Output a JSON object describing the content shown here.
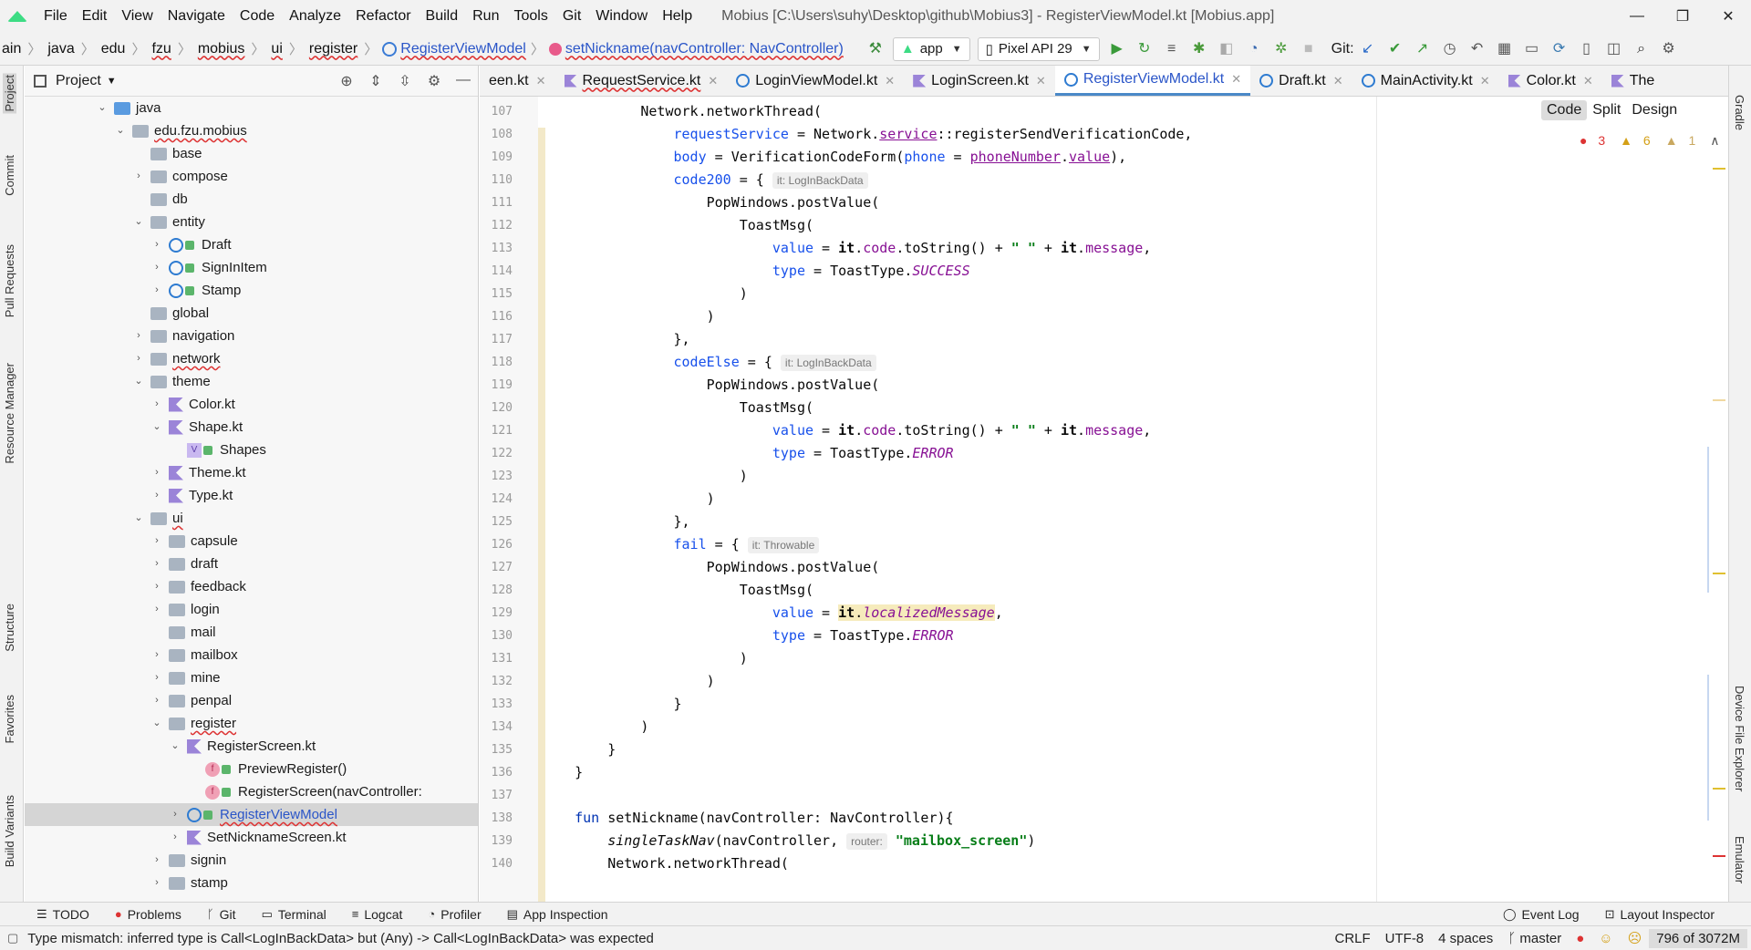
{
  "window": {
    "title": "Mobius [C:\\Users\\suhy\\Desktop\\github\\Mobius3] - RegisterViewModel.kt [Mobius.app]",
    "minimize": "—",
    "restore": "❐",
    "close": "✕"
  },
  "menu": [
    "File",
    "Edit",
    "View",
    "Navigate",
    "Code",
    "Analyze",
    "Refactor",
    "Build",
    "Run",
    "Tools",
    "Git",
    "Window",
    "Help"
  ],
  "breadcrumb": {
    "items": [
      "ain",
      "java",
      "edu",
      "fzu",
      "mobius",
      "ui",
      "register"
    ],
    "class_name": "RegisterViewModel",
    "function_name": "setNickname(navController: NavController)"
  },
  "toolbar": {
    "run_config": "app",
    "device": "Pixel API 29",
    "git_label": "Git:"
  },
  "project_panel": {
    "title": "Project",
    "tree": [
      {
        "label": "java",
        "depth": 0,
        "arrow": "down",
        "icon": "folder-blue"
      },
      {
        "label": "edu.fzu.mobius",
        "depth": 1,
        "arrow": "down",
        "icon": "folder",
        "underline": true
      },
      {
        "label": "base",
        "depth": 2,
        "arrow": "",
        "icon": "folder"
      },
      {
        "label": "compose",
        "depth": 2,
        "arrow": "right",
        "icon": "folder"
      },
      {
        "label": "db",
        "depth": 2,
        "arrow": "",
        "icon": "folder"
      },
      {
        "label": "entity",
        "depth": 2,
        "arrow": "down",
        "icon": "folder"
      },
      {
        "label": "Draft",
        "depth": 3,
        "arrow": "right",
        "icon": "class"
      },
      {
        "label": "SignInItem",
        "depth": 3,
        "arrow": "right",
        "icon": "class"
      },
      {
        "label": "Stamp",
        "depth": 3,
        "arrow": "right",
        "icon": "class"
      },
      {
        "label": "global",
        "depth": 2,
        "arrow": "",
        "icon": "folder"
      },
      {
        "label": "navigation",
        "depth": 2,
        "arrow": "right",
        "icon": "folder"
      },
      {
        "label": "network",
        "depth": 2,
        "arrow": "right",
        "icon": "folder",
        "underline": true
      },
      {
        "label": "theme",
        "depth": 2,
        "arrow": "down",
        "icon": "folder"
      },
      {
        "label": "Color.kt",
        "depth": 3,
        "arrow": "right",
        "icon": "kfile"
      },
      {
        "label": "Shape.kt",
        "depth": 3,
        "arrow": "down",
        "icon": "kfile"
      },
      {
        "label": "Shapes",
        "depth": 4,
        "arrow": "",
        "icon": "val"
      },
      {
        "label": "Theme.kt",
        "depth": 3,
        "arrow": "right",
        "icon": "kfile"
      },
      {
        "label": "Type.kt",
        "depth": 3,
        "arrow": "right",
        "icon": "kfile"
      },
      {
        "label": "ui",
        "depth": 2,
        "arrow": "down",
        "icon": "folder",
        "underline": true
      },
      {
        "label": "capsule",
        "depth": 3,
        "arrow": "right",
        "icon": "folder"
      },
      {
        "label": "draft",
        "depth": 3,
        "arrow": "right",
        "icon": "folder"
      },
      {
        "label": "feedback",
        "depth": 3,
        "arrow": "right",
        "icon": "folder"
      },
      {
        "label": "login",
        "depth": 3,
        "arrow": "right",
        "icon": "folder"
      },
      {
        "label": "mail",
        "depth": 3,
        "arrow": "",
        "icon": "folder"
      },
      {
        "label": "mailbox",
        "depth": 3,
        "arrow": "right",
        "icon": "folder"
      },
      {
        "label": "mine",
        "depth": 3,
        "arrow": "right",
        "icon": "folder"
      },
      {
        "label": "penpal",
        "depth": 3,
        "arrow": "right",
        "icon": "folder"
      },
      {
        "label": "register",
        "depth": 3,
        "arrow": "down",
        "icon": "folder",
        "underline": true
      },
      {
        "label": "RegisterScreen.kt",
        "depth": 4,
        "arrow": "down",
        "icon": "kfile"
      },
      {
        "label": "PreviewRegister()",
        "depth": 5,
        "arrow": "",
        "icon": "fn"
      },
      {
        "label": "RegisterScreen(navController:",
        "depth": 5,
        "arrow": "",
        "icon": "fn"
      },
      {
        "label": "RegisterViewModel",
        "depth": 4,
        "arrow": "right",
        "icon": "class",
        "selected": true,
        "link": true
      },
      {
        "label": "SetNicknameScreen.kt",
        "depth": 4,
        "arrow": "right",
        "icon": "kfile"
      },
      {
        "label": "signin",
        "depth": 3,
        "arrow": "right",
        "icon": "folder"
      },
      {
        "label": "stamp",
        "depth": 3,
        "arrow": "right",
        "icon": "folder"
      }
    ]
  },
  "editor_tabs": [
    {
      "label": "een.kt",
      "icon": "kfile"
    },
    {
      "label": "RequestService.kt",
      "icon": "kfile",
      "underline": true
    },
    {
      "label": "LoginViewModel.kt",
      "icon": "class"
    },
    {
      "label": "LoginScreen.kt",
      "icon": "kfile"
    },
    {
      "label": "RegisterViewModel.kt",
      "icon": "class",
      "active": true
    },
    {
      "label": "Draft.kt",
      "icon": "class"
    },
    {
      "label": "MainActivity.kt",
      "icon": "class"
    },
    {
      "label": "Color.kt",
      "icon": "kfile"
    },
    {
      "label": "The",
      "icon": "kfile"
    }
  ],
  "view_switch": [
    "Code",
    "Split",
    "Design"
  ],
  "inspections": {
    "errors": "3",
    "warnings": "6",
    "weak_warnings": "1"
  },
  "code": {
    "line_numbers": [
      "107",
      "108",
      "109",
      "110",
      "111",
      "112",
      "113",
      "114",
      "115",
      "116",
      "117",
      "118",
      "119",
      "120",
      "121",
      "122",
      "123",
      "124",
      "125",
      "126",
      "127",
      "128",
      "129",
      "130",
      "131",
      "132",
      "133",
      "134",
      "135",
      "136",
      "137",
      "138",
      "139",
      "140"
    ],
    "hint_it_logIn": "it: LogInBackData",
    "hint_it_throwable": "it: Throwable",
    "hint_router": "router:"
  },
  "bottom_tools": [
    "TODO",
    "Problems",
    "Git",
    "Terminal",
    "Logcat",
    "Profiler",
    "App Inspection",
    "Event Log",
    "Layout Inspector"
  ],
  "left_stripe": [
    "Project",
    "Commit",
    "Pull Requests",
    "Resource Manager",
    "Structure",
    "Favorites",
    "Build Variants"
  ],
  "right_stripe": [
    "Gradle",
    "Device File Explorer",
    "Emulator"
  ],
  "status": {
    "message": "Type mismatch: inferred type is Call<LogInBackData> but (Any) -> Call<LogInBackData> was expected",
    "line_sep": "CRLF",
    "encoding": "UTF-8",
    "indent": "4 spaces",
    "branch": "master",
    "memory": "796 of 3072M"
  }
}
